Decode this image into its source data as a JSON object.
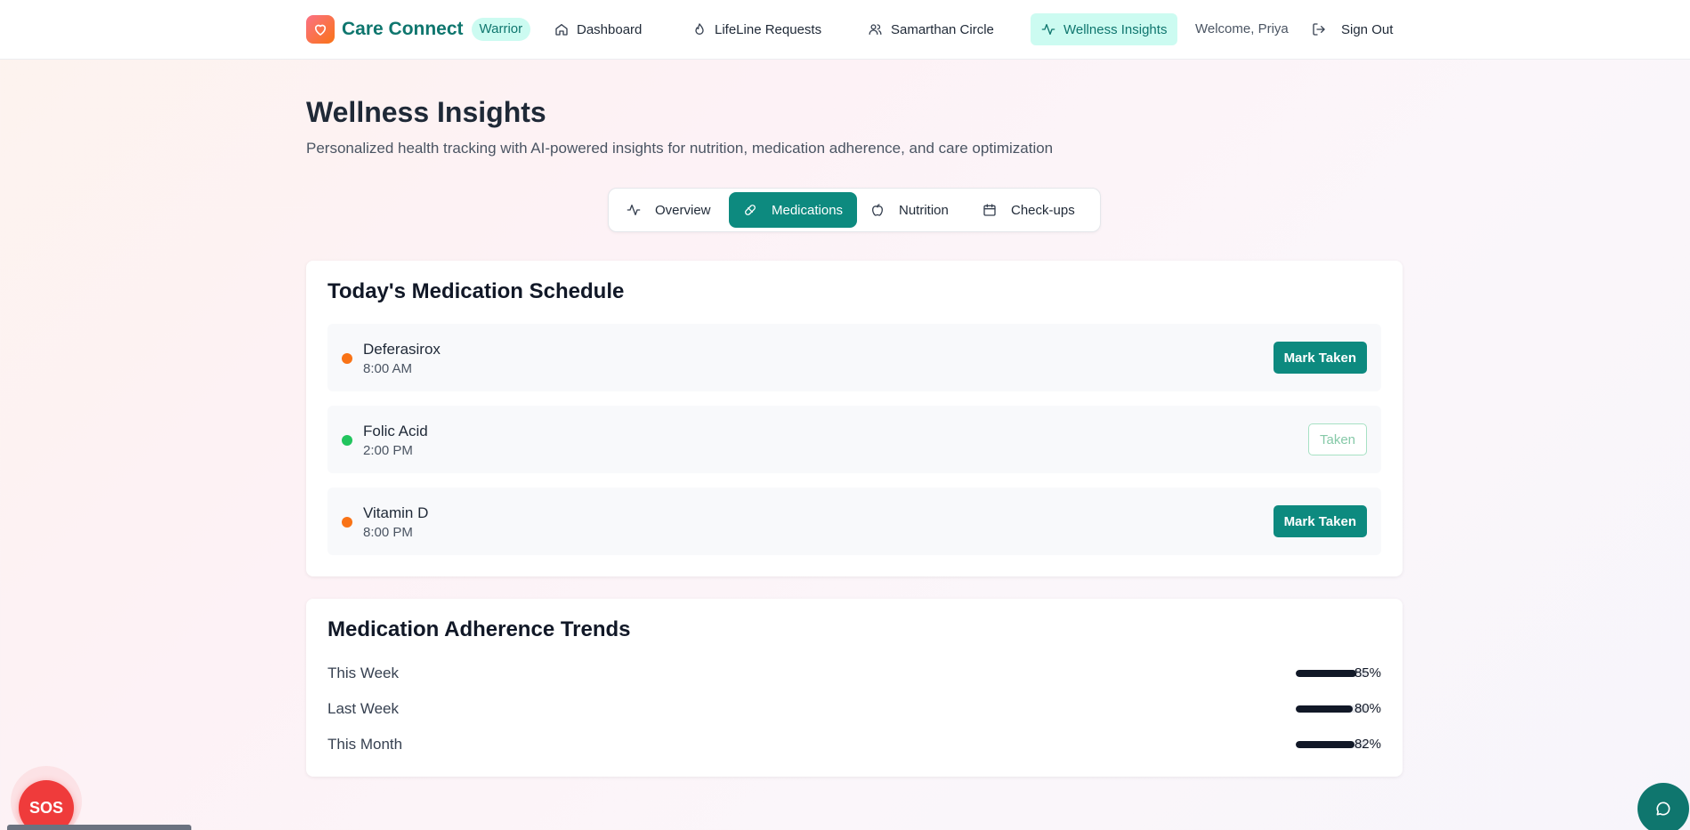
{
  "app": {
    "name": "Care Connect",
    "role_badge": "Warrior"
  },
  "nav": {
    "items": [
      {
        "label": "Dashboard",
        "icon": "home-icon"
      },
      {
        "label": "LifeLine Requests",
        "icon": "drop-icon"
      },
      {
        "label": "Samarthan Circle",
        "icon": "users-icon"
      },
      {
        "label": "Wellness Insights",
        "icon": "activity-icon",
        "active": true
      }
    ],
    "welcome": "Welcome, Priya",
    "sign_out": "Sign Out"
  },
  "page": {
    "title": "Wellness Insights",
    "subtitle": "Personalized health tracking with AI-powered insights for nutrition, medication adherence, and care optimization"
  },
  "tabs": [
    {
      "label": "Overview",
      "icon": "activity-icon"
    },
    {
      "label": "Medications",
      "icon": "pill-icon",
      "active": true
    },
    {
      "label": "Nutrition",
      "icon": "apple-icon"
    },
    {
      "label": "Check-ups",
      "icon": "calendar-icon"
    }
  ],
  "schedule": {
    "title": "Today's Medication Schedule",
    "items": [
      {
        "name": "Deferasirox",
        "time": "8:00 AM",
        "status_color": "#f97316",
        "action": "Mark Taken"
      },
      {
        "name": "Folic Acid",
        "time": "2:00 PM",
        "status_color": "#22c55e",
        "action": "Taken"
      },
      {
        "name": "Vitamin D",
        "time": "8:00 PM",
        "status_color": "#f97316",
        "action": "Mark Taken"
      }
    ]
  },
  "adherence": {
    "title": "Medication Adherence Trends",
    "rows": [
      {
        "label": "This Week",
        "value": "85%",
        "fraction": 0.85
      },
      {
        "label": "Last Week",
        "value": "80%",
        "fraction": 0.8
      },
      {
        "label": "This Month",
        "value": "82%",
        "fraction": 0.82
      }
    ]
  },
  "sos": {
    "label": "SOS"
  },
  "colors": {
    "accent": "#0d8a7f",
    "accent_soft": "#ccfbf1",
    "sos": "#ef3b3b"
  }
}
